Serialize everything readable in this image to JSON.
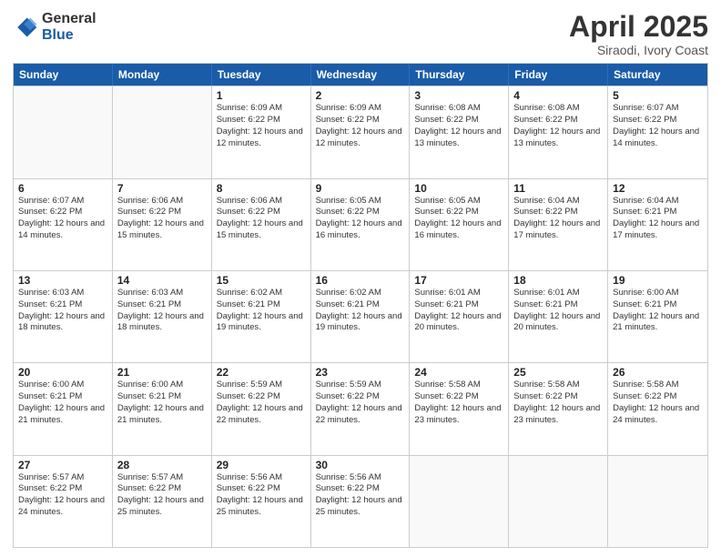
{
  "header": {
    "logo_general": "General",
    "logo_blue": "Blue",
    "title": "April 2025",
    "location": "Siraodi, Ivory Coast"
  },
  "days_of_week": [
    "Sunday",
    "Monday",
    "Tuesday",
    "Wednesday",
    "Thursday",
    "Friday",
    "Saturday"
  ],
  "weeks": [
    [
      {
        "day": "",
        "info": ""
      },
      {
        "day": "",
        "info": ""
      },
      {
        "day": "1",
        "info": "Sunrise: 6:09 AM\nSunset: 6:22 PM\nDaylight: 12 hours and 12 minutes."
      },
      {
        "day": "2",
        "info": "Sunrise: 6:09 AM\nSunset: 6:22 PM\nDaylight: 12 hours and 12 minutes."
      },
      {
        "day": "3",
        "info": "Sunrise: 6:08 AM\nSunset: 6:22 PM\nDaylight: 12 hours and 13 minutes."
      },
      {
        "day": "4",
        "info": "Sunrise: 6:08 AM\nSunset: 6:22 PM\nDaylight: 12 hours and 13 minutes."
      },
      {
        "day": "5",
        "info": "Sunrise: 6:07 AM\nSunset: 6:22 PM\nDaylight: 12 hours and 14 minutes."
      }
    ],
    [
      {
        "day": "6",
        "info": "Sunrise: 6:07 AM\nSunset: 6:22 PM\nDaylight: 12 hours and 14 minutes."
      },
      {
        "day": "7",
        "info": "Sunrise: 6:06 AM\nSunset: 6:22 PM\nDaylight: 12 hours and 15 minutes."
      },
      {
        "day": "8",
        "info": "Sunrise: 6:06 AM\nSunset: 6:22 PM\nDaylight: 12 hours and 15 minutes."
      },
      {
        "day": "9",
        "info": "Sunrise: 6:05 AM\nSunset: 6:22 PM\nDaylight: 12 hours and 16 minutes."
      },
      {
        "day": "10",
        "info": "Sunrise: 6:05 AM\nSunset: 6:22 PM\nDaylight: 12 hours and 16 minutes."
      },
      {
        "day": "11",
        "info": "Sunrise: 6:04 AM\nSunset: 6:22 PM\nDaylight: 12 hours and 17 minutes."
      },
      {
        "day": "12",
        "info": "Sunrise: 6:04 AM\nSunset: 6:21 PM\nDaylight: 12 hours and 17 minutes."
      }
    ],
    [
      {
        "day": "13",
        "info": "Sunrise: 6:03 AM\nSunset: 6:21 PM\nDaylight: 12 hours and 18 minutes."
      },
      {
        "day": "14",
        "info": "Sunrise: 6:03 AM\nSunset: 6:21 PM\nDaylight: 12 hours and 18 minutes."
      },
      {
        "day": "15",
        "info": "Sunrise: 6:02 AM\nSunset: 6:21 PM\nDaylight: 12 hours and 19 minutes."
      },
      {
        "day": "16",
        "info": "Sunrise: 6:02 AM\nSunset: 6:21 PM\nDaylight: 12 hours and 19 minutes."
      },
      {
        "day": "17",
        "info": "Sunrise: 6:01 AM\nSunset: 6:21 PM\nDaylight: 12 hours and 20 minutes."
      },
      {
        "day": "18",
        "info": "Sunrise: 6:01 AM\nSunset: 6:21 PM\nDaylight: 12 hours and 20 minutes."
      },
      {
        "day": "19",
        "info": "Sunrise: 6:00 AM\nSunset: 6:21 PM\nDaylight: 12 hours and 21 minutes."
      }
    ],
    [
      {
        "day": "20",
        "info": "Sunrise: 6:00 AM\nSunset: 6:21 PM\nDaylight: 12 hours and 21 minutes."
      },
      {
        "day": "21",
        "info": "Sunrise: 6:00 AM\nSunset: 6:21 PM\nDaylight: 12 hours and 21 minutes."
      },
      {
        "day": "22",
        "info": "Sunrise: 5:59 AM\nSunset: 6:22 PM\nDaylight: 12 hours and 22 minutes."
      },
      {
        "day": "23",
        "info": "Sunrise: 5:59 AM\nSunset: 6:22 PM\nDaylight: 12 hours and 22 minutes."
      },
      {
        "day": "24",
        "info": "Sunrise: 5:58 AM\nSunset: 6:22 PM\nDaylight: 12 hours and 23 minutes."
      },
      {
        "day": "25",
        "info": "Sunrise: 5:58 AM\nSunset: 6:22 PM\nDaylight: 12 hours and 23 minutes."
      },
      {
        "day": "26",
        "info": "Sunrise: 5:58 AM\nSunset: 6:22 PM\nDaylight: 12 hours and 24 minutes."
      }
    ],
    [
      {
        "day": "27",
        "info": "Sunrise: 5:57 AM\nSunset: 6:22 PM\nDaylight: 12 hours and 24 minutes."
      },
      {
        "day": "28",
        "info": "Sunrise: 5:57 AM\nSunset: 6:22 PM\nDaylight: 12 hours and 25 minutes."
      },
      {
        "day": "29",
        "info": "Sunrise: 5:56 AM\nSunset: 6:22 PM\nDaylight: 12 hours and 25 minutes."
      },
      {
        "day": "30",
        "info": "Sunrise: 5:56 AM\nSunset: 6:22 PM\nDaylight: 12 hours and 25 minutes."
      },
      {
        "day": "",
        "info": ""
      },
      {
        "day": "",
        "info": ""
      },
      {
        "day": "",
        "info": ""
      }
    ]
  ]
}
